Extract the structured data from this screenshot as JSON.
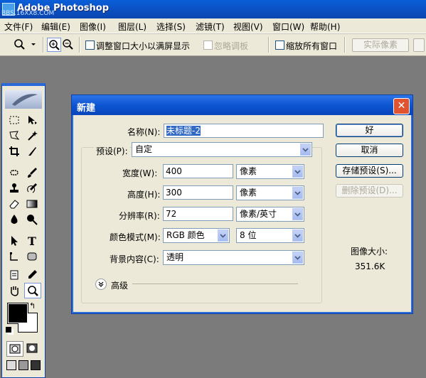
{
  "app": {
    "title": "Adobe Photoshop",
    "watermark": "BBS.16XX8.COM"
  },
  "menu": [
    "文件(F)",
    "编辑(E)",
    "图像(I)",
    "图层(L)",
    "选择(S)",
    "滤镜(T)",
    "视图(V)",
    "窗口(W)",
    "帮助(H)"
  ],
  "options": {
    "resize_window_label": "调整窗口大小以满屏显示",
    "ignore_palettes_label": "忽略调板",
    "zoom_all_label": "缩放所有窗口",
    "actual_pixels_label": "实际像素"
  },
  "dialog": {
    "title": "新建",
    "close": "✕",
    "name_label": "名称(N):",
    "name_value": "未标题-2",
    "preset_label": "预设(P):",
    "preset_value": "自定",
    "width_label": "宽度(W):",
    "width_value": "400",
    "width_unit": "像素",
    "height_label": "高度(H):",
    "height_value": "300",
    "height_unit": "像素",
    "resolution_label": "分辨率(R):",
    "resolution_value": "72",
    "resolution_unit": "像素/英寸",
    "color_mode_label": "颜色模式(M):",
    "color_mode_value": "RGB 颜色",
    "bit_depth_value": "8 位",
    "background_label": "背景内容(C):",
    "background_value": "透明",
    "advanced_label": "高级",
    "ok_label": "好",
    "cancel_label": "取消",
    "save_preset_label": "存储预设(S)...",
    "delete_preset_label": "删除预设(D)...",
    "image_size_label": "图像大小:",
    "image_size_value": "351.6K"
  }
}
